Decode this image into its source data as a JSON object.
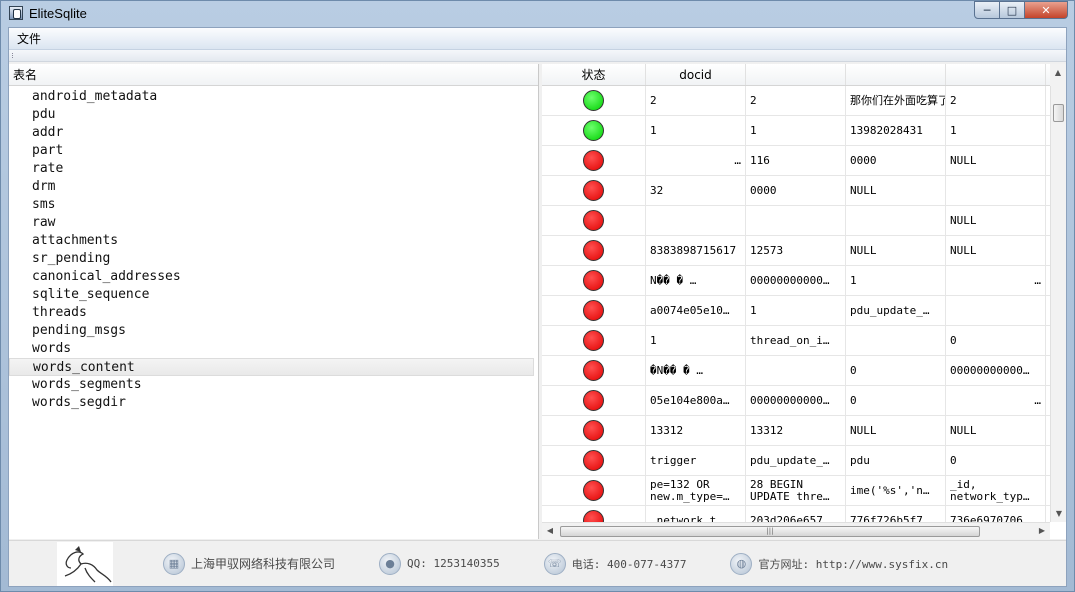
{
  "window": {
    "title": "EliteSqlite",
    "minimize": "─",
    "maximize": "□",
    "close": "✕"
  },
  "menu": [
    "文件"
  ],
  "left_panel": {
    "header": "表名",
    "tables": [
      "android_metadata",
      "pdu",
      "addr",
      "part",
      "rate",
      "drm",
      "sms",
      "raw",
      "attachments",
      "sr_pending",
      "canonical_addresses",
      "sqlite_sequence",
      "threads",
      "pending_msgs",
      "words",
      "words_content",
      "words_segments",
      "words_segdir"
    ],
    "selected": "words_content"
  },
  "grid": {
    "headers": [
      "状态",
      "docid",
      "",
      "",
      "",
      ""
    ],
    "rows": [
      {
        "status": "green",
        "cells": [
          "2",
          "2",
          "那你们在外面吃算了!怕时间…",
          "2",
          ""
        ]
      },
      {
        "status": "green",
        "cells": [
          "1",
          "1",
          "13982028431",
          "1",
          ""
        ]
      },
      {
        "status": "red",
        "cells": [
          "…",
          "116",
          "0000",
          "NULL",
          ""
        ]
      },
      {
        "status": "red",
        "cells": [
          "32",
          "0000",
          "NULL",
          "",
          ""
        ]
      },
      {
        "status": "red",
        "cells": [
          "",
          "",
          "",
          "NULL",
          ""
        ]
      },
      {
        "status": "red",
        "cells": [
          "8383898715617",
          "12573",
          "NULL",
          "NULL",
          ""
        ]
      },
      {
        "status": "red",
        "cells": [
          "N�� �   …",
          "00000000000…",
          "1",
          "…",
          ""
        ]
      },
      {
        "status": "red",
        "cells": [
          "a0074e05e10…",
          "1",
          "pdu_update_…",
          "",
          ""
        ]
      },
      {
        "status": "red",
        "cells": [
          "1",
          "thread_on_i…",
          "",
          "0",
          ""
        ]
      },
      {
        "status": "red",
        "cells": [
          "�N�� �  …",
          "",
          "0",
          "00000000000…",
          ""
        ]
      },
      {
        "status": "red",
        "cells": [
          "05e104e800a…",
          "00000000000…",
          "0",
          "…",
          ""
        ]
      },
      {
        "status": "red",
        "cells": [
          "13312",
          "13312",
          "NULL",
          "NULL",
          ""
        ]
      },
      {
        "status": "red",
        "cells": [
          "trigger",
          "pdu_update_…",
          "pdu",
          "0",
          ""
        ]
      },
      {
        "status": "red",
        "cells": [
          "pe=132    OR new.m_type=…",
          "28 BEGIN UPDATE thre…",
          "ime('%s','n…",
          "_id, network_typ…",
          ""
        ]
      },
      {
        "status": "red",
        "cells": [
          "…network_t…",
          "203d206e657…",
          "776f726b5f7…",
          "736e6970706…",
          ""
        ]
      }
    ]
  },
  "footer": {
    "company": "上海甲驭网络科技有限公司",
    "qq": "QQ: 1253140355",
    "phone": "电话: 400-077-4377",
    "website": "官方网址: http://www.sysfix.cn"
  },
  "colors": {
    "status_green": "#00d000",
    "status_red": "#e00000"
  }
}
